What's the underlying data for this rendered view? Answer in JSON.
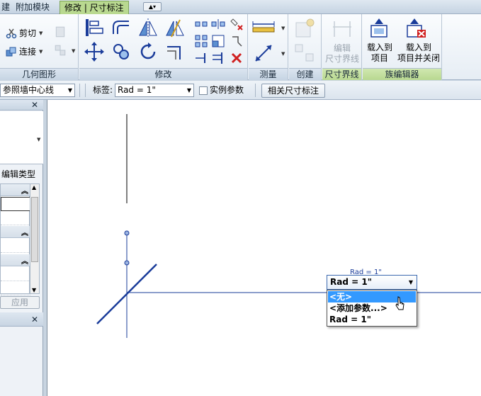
{
  "tabs": [
    {
      "label": "建"
    },
    {
      "label": "附加模块"
    },
    {
      "label": "修改 | 尺寸标注"
    }
  ],
  "ribbon": {
    "panels": {
      "geometry": {
        "label": "几何图形",
        "cut": "剪切",
        "join": "连接"
      },
      "modify": {
        "label": "修改"
      },
      "measure": {
        "label": "测量"
      },
      "create": {
        "label": "创建"
      },
      "witness": {
        "label": "尺寸界线",
        "edit_line1": "编辑",
        "edit_line2": "尺寸界线"
      },
      "family_editor": {
        "label": "族编辑器",
        "load_line1": "载入到",
        "load_line2": "项目",
        "load_close_line1": "载入到",
        "load_close_line2": "项目并关闭"
      }
    }
  },
  "options_bar": {
    "ref_combo": "参照墙中心线",
    "label_caption": "标签:",
    "label_value": "Rad = 1\"",
    "instance_param": "实例参数",
    "related_dims": "相关尺寸标注"
  },
  "properties": {
    "edit_type": "编辑类型",
    "apply": "应用"
  },
  "canvas": {
    "dim_text": "Rad = 1\"",
    "dropdown": {
      "value": "Rad = 1\"",
      "options": [
        "<无>",
        "<添加参数...>",
        "Rad = 1\""
      ],
      "selected_index": 0
    }
  },
  "colors": {
    "accent_tab": "#b9d990",
    "selection": "#3399ff",
    "dim_line": "#1a3c9a"
  }
}
